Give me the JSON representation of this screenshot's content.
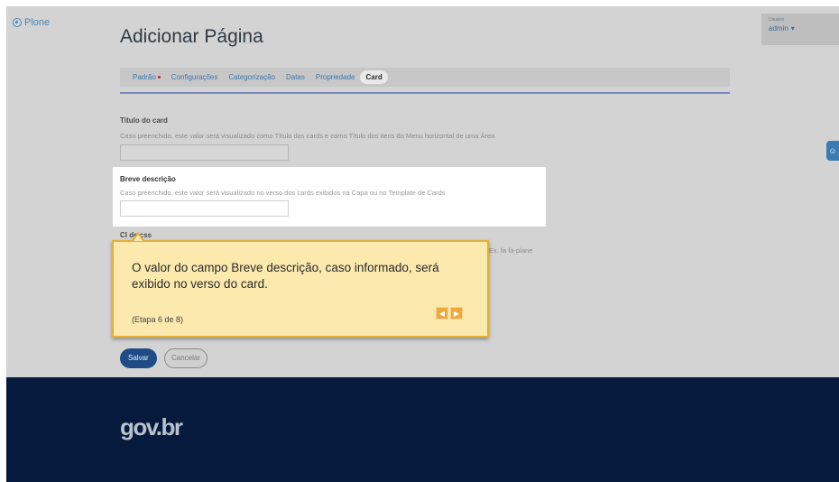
{
  "header": {
    "logo_text": "Plone",
    "user_small": "Usuário",
    "user_name": "admin"
  },
  "page": {
    "title": "Adicionar Página"
  },
  "tabs": [
    {
      "label": "Padrão",
      "required": true
    },
    {
      "label": "Configurações"
    },
    {
      "label": "Categorização"
    },
    {
      "label": "Datas"
    },
    {
      "label": "Propriedade"
    },
    {
      "label": "Card",
      "active": true
    }
  ],
  "fields": {
    "card_title": {
      "label": "Título do card",
      "help": "Caso preenchido, este valor será visualizado como Título dos cards e como Título dos itens do Menu horizontal de uma Área",
      "value": ""
    },
    "short_description": {
      "label": "Breve descrição",
      "help": "Caso preenchido, este valor será visualizado no verso dos cards exibidos na Capa ou no Template de Cards",
      "value": ""
    },
    "css_class": {
      "label": "Cl   de css",
      "help_partial": "Ex. fa fa-plane"
    }
  },
  "buttons": {
    "save": "Salvar",
    "cancel": "Cancelar"
  },
  "footer": {
    "logo_text": "gov.br"
  },
  "tour": {
    "message": "O valor do campo Breve descrição, caso informado, será exibido no verso do card.",
    "step": "(Etapa 6 de 8)",
    "prev_icon": "chevron-left-icon",
    "next_icon": "chevron-right-icon"
  },
  "side_widget_icon": "accessibility-icon",
  "colors": {
    "accent": "#1f4c87",
    "footer_bg": "#061a3d",
    "tooltip_bg": "#fbe9ad",
    "tooltip_border": "#e3b03c",
    "required_dot": "#d0202a"
  }
}
